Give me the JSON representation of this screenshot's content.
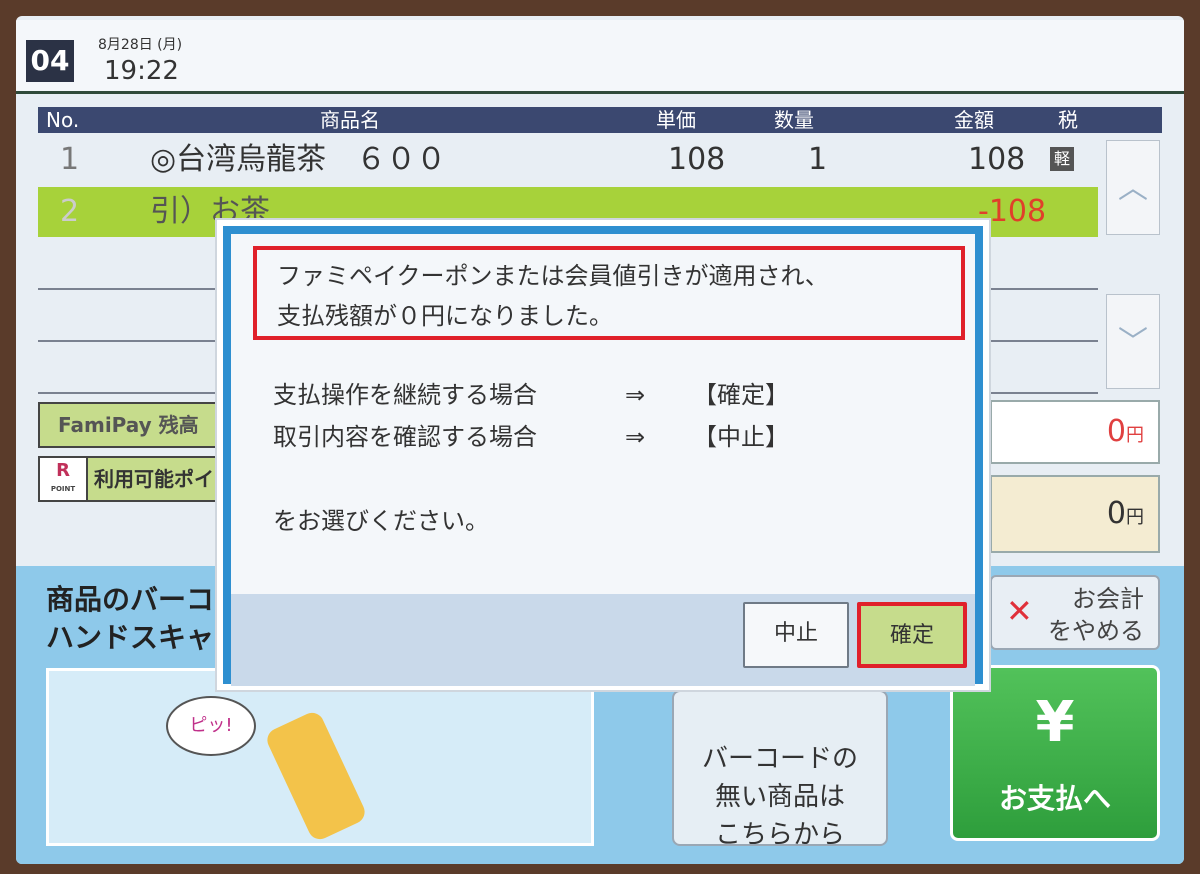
{
  "header": {
    "register_no": "04",
    "date": "8月28日 (月)",
    "time": "19:22"
  },
  "table": {
    "columns": [
      "No.",
      "商品名",
      "単価",
      "数量",
      "金額",
      "税"
    ],
    "rows": [
      {
        "no": "1",
        "name": "◎台湾烏龍茶　６００",
        "unit_price": "108",
        "qty": "1",
        "amount": "108",
        "tax": "軽"
      },
      {
        "no": "2",
        "name": "引）お茶",
        "unit_price": "",
        "qty": "",
        "amount": "-108",
        "tax": ""
      }
    ]
  },
  "scroll": {
    "up": "︿",
    "down": "﹀"
  },
  "famipay": {
    "label": "FamiPay 残高",
    "amount": "0",
    "unit": "円"
  },
  "rpoint": {
    "logo": "R",
    "logo_sub": "POINT",
    "label": "利用可能ポイント",
    "amount": "0",
    "unit": "円"
  },
  "scan_hint": {
    "line1": "商品のバーコードを",
    "line2": "ハンドスキャナで"
  },
  "illustration": {
    "bubble": "ピッ!"
  },
  "no_barcode_button": {
    "line1": "バーコードの",
    "line2": "無い商品は",
    "line3": "こちらから"
  },
  "cancel_checkout": {
    "icon": "✕",
    "line1": "お会計",
    "line2": "をやめる"
  },
  "pay_button": {
    "icon": "¥",
    "label": "お支払へ"
  },
  "dialog": {
    "message_line1": "ファミペイクーポンまたは会員値引きが適用され、",
    "message_line2": "支払残額が０円になりました。",
    "continue_text": "支払操作を継続する場合",
    "review_text": "取引内容を確認する場合",
    "arrow": "⇒",
    "continue_option": "【確定】",
    "review_option": "【中止】",
    "prompt": "をお選びください。",
    "cancel_label": "中止",
    "confirm_label": "確定"
  },
  "colors": {
    "header_bar": "#3b4870",
    "discount_row": "#a7d23a",
    "dialog_border": "#2e8fd0",
    "highlight": "#e0202a",
    "pay": "#2e9e3c"
  }
}
